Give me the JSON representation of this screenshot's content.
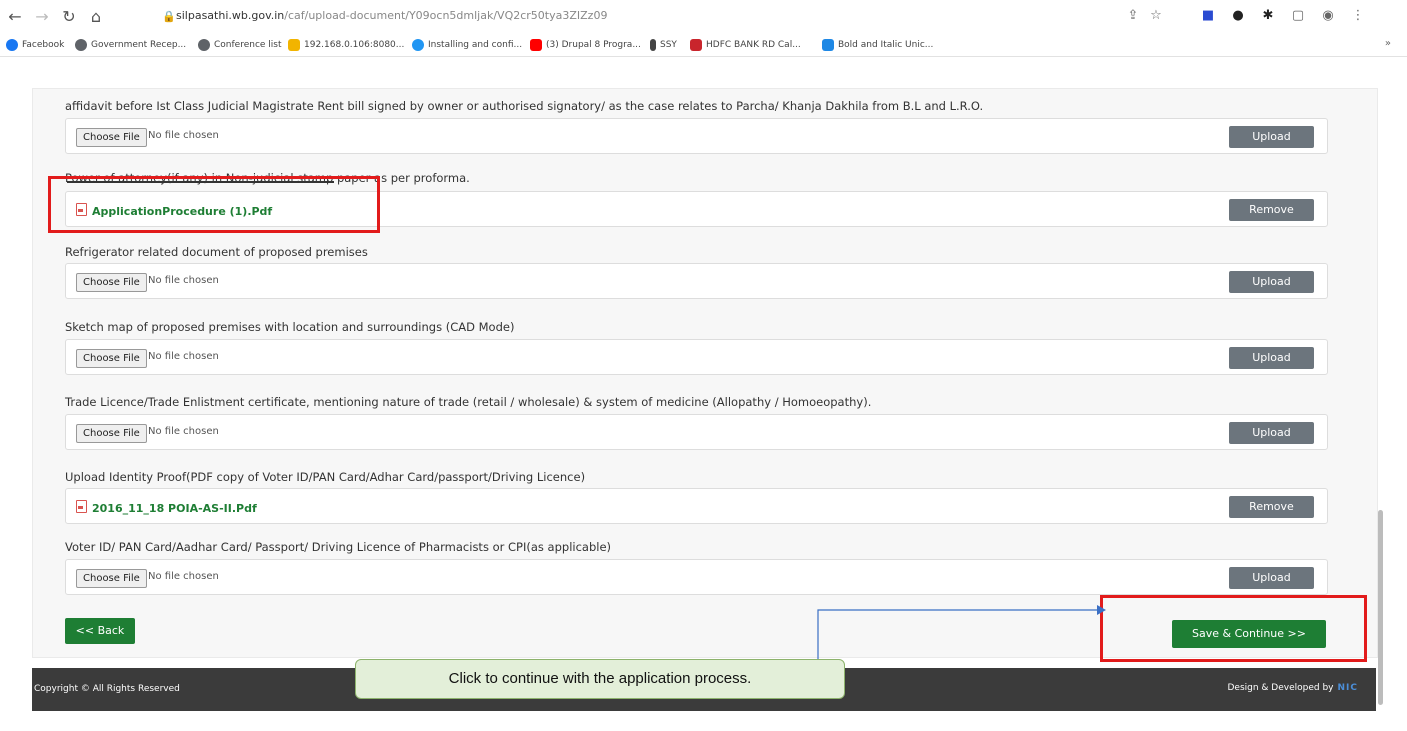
{
  "browser": {
    "url_host": "silpasathi.wb.gov.in",
    "url_path": "/caf/upload-document/Y09ocn5dmljak/VQ2cr50tya3ZIZz09",
    "bookmarks": [
      {
        "label": "Facebook",
        "color": "#1877f2"
      },
      {
        "label": "Government Recep...",
        "color": "#5f6368"
      },
      {
        "label": "Conference list",
        "color": "#5f6368"
      },
      {
        "label": "192.168.0.106:8080...",
        "color": "#f2b400"
      },
      {
        "label": "Installing and confi...",
        "color": "#2196f3"
      },
      {
        "label": "(3) Drupal 8 Progra...",
        "color": "#ff0000"
      },
      {
        "label": "SSY",
        "color": "#444444"
      },
      {
        "label": "HDFC BANK RD Cal...",
        "color": "#c9252c"
      },
      {
        "label": "Bold and Italic Unic...",
        "color": "#1e88e5"
      }
    ],
    "more": "»"
  },
  "documents": [
    {
      "label": "affidavit before Ist Class Judicial Magistrate Rent bill signed by owner or authorised signatory/ as the case relates to Parcha/ Khanja Dakhila from B.L and L.R.O.",
      "choose": "Choose File",
      "status": "No file chosen",
      "action": "Upload"
    },
    {
      "label": "Power of attorney(if any) in Non-judicial stamp paper as per proforma.",
      "file": "ApplicationProcedure (1).Pdf",
      "action": "Remove"
    },
    {
      "label": "Refrigerator related document of proposed premises",
      "choose": "Choose File",
      "status": "No file chosen",
      "action": "Upload"
    },
    {
      "label": "Sketch map of proposed premises with location and surroundings (CAD Mode)",
      "choose": "Choose File",
      "status": "No file chosen",
      "action": "Upload"
    },
    {
      "label": "Trade Licence/Trade Enlistment certificate, mentioning nature of trade (retail / wholesale) & system of medicine (Allopathy / Homoeopathy).",
      "choose": "Choose File",
      "status": "No file chosen",
      "action": "Upload"
    },
    {
      "label": "Upload Identity Proof(PDF copy of Voter ID/PAN Card/Adhar Card/passport/Driving Licence)",
      "file": "2016_11_18 POIA-AS-II.Pdf",
      "action": "Remove"
    },
    {
      "label": "Voter ID/ PAN Card/Aadhar Card/ Passport/ Driving Licence of Pharmacists or CPI(as applicable)",
      "choose": "Choose File",
      "status": "No file chosen",
      "action": "Upload"
    }
  ],
  "buttons": {
    "back": "<< Back",
    "save": "Save & Continue >>"
  },
  "footer": {
    "copyright": "Copyright © All Rights Reserved",
    "design": "Design & Developed by",
    "brand": "NIC"
  },
  "tooltip": "Click to continue with the application process."
}
